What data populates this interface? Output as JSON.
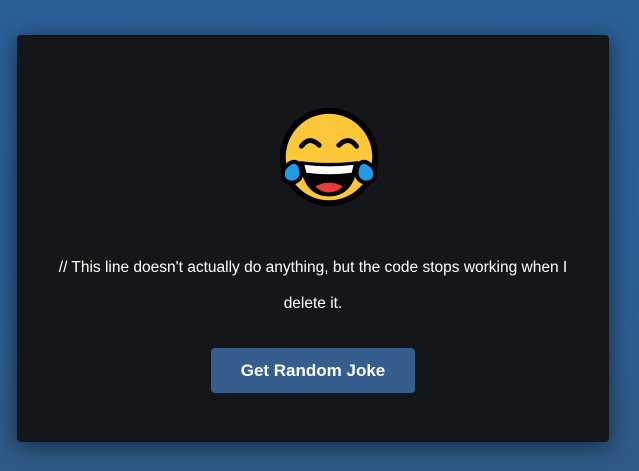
{
  "joke": {
    "emoji": "face-with-tears-of-joy-icon",
    "text": "// This line doesn't actually do anything, but the code stops working when I delete it."
  },
  "button": {
    "label": "Get Random Joke"
  },
  "colors": {
    "background": "#2b5f97",
    "card": "#141619",
    "button": "#355e8e",
    "text": "#ffffff"
  }
}
